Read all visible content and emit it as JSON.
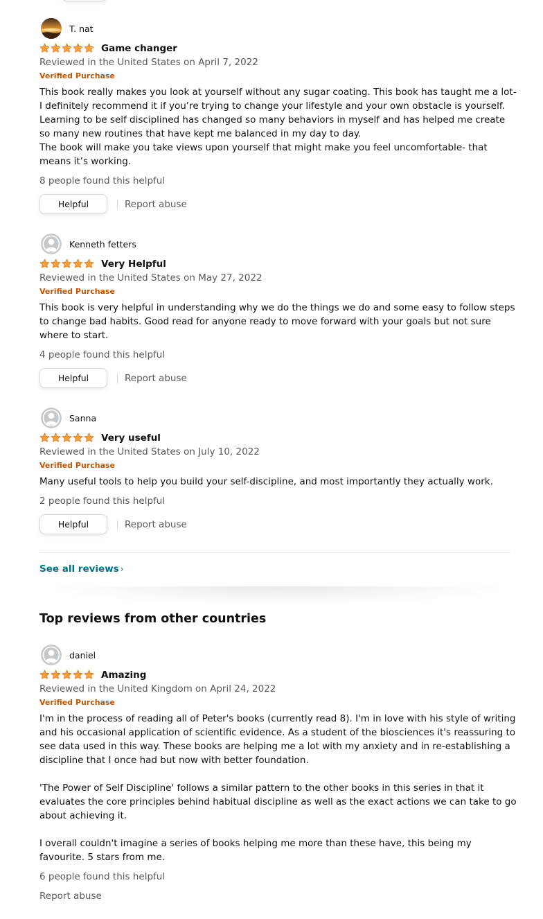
{
  "reviews": [
    {
      "name": "T. nat",
      "avatar": "photo",
      "rating": 5,
      "title": "Game changer",
      "date": "Reviewed in the United States on April 7, 2022",
      "verified": "Verified Purchase",
      "body": "This book really makes you look at yourself without any sugar coating. This book has taught me a lot- I definitely recommend it if you’re trying to change your lifestyle and your own obstacle is yourself.\nLearning to be self disciplined has changed so many behaviors in myself and has helped me create so many new routines that have kept me balanced in my day to day.\nThe book will make you take views upon yourself that might make you feel uncomfortable- that means it’s working.",
      "helpful_count": "8 people found this helpful",
      "helpful_label": "Helpful",
      "report_label": "Report abuse"
    },
    {
      "name": "Kenneth fetters",
      "avatar": "default",
      "rating": 5,
      "title": "Very Helpful",
      "date": "Reviewed in the United States on May 27, 2022",
      "verified": "Verified Purchase",
      "body": "This book is very helpful in understanding why we do the things we do and some easy to follow steps to change bad habits. Good read for anyone ready to move forward with your goals but not sure where to start.",
      "helpful_count": "4 people found this helpful",
      "helpful_label": "Helpful",
      "report_label": "Report abuse"
    },
    {
      "name": "Sanna",
      "avatar": "default",
      "rating": 5,
      "title": "Very useful",
      "date": "Reviewed in the United States on July 10, 2022",
      "verified": "Verified Purchase",
      "body": "Many useful tools to help you build your self-discipline, and most importantly they actually work.",
      "helpful_count": "2 people found this helpful",
      "helpful_label": "Helpful",
      "report_label": "Report abuse"
    }
  ],
  "see_all": {
    "label": "See all reviews",
    "chevron": "›"
  },
  "other_countries": {
    "heading": "Top reviews from other countries",
    "reviews": [
      {
        "name": "daniel",
        "avatar": "default",
        "rating": 5,
        "title": "Amazing",
        "date": "Reviewed in the United Kingdom on April 24, 2022",
        "verified": "Verified Purchase",
        "body": "I'm in the process of reading all of Peter's books (currently read 8). I'm in love with his style of writing and his occasional application of scientific evidence. As a student of the biosciences it's reassuring to see data used in this way. These books are helping me a lot with my anxiety and in re-establishing a discipline that I once had but now with better foundation.\n\n'The Power of Self Discipline' follows a similar pattern to the other books in this series in that it evaluates the core principles behind habitual discipline as well as the exact actions we can take to go about achieving it.\n\nI overall couldn't imagine a series of books helping me more than these have, this being my favourite. 5 stars from me.",
        "helpful_count": "6 people found this helpful",
        "report_label": "Report abuse"
      }
    ]
  },
  "colors": {
    "star": "#f7a33d",
    "star_stroke": "#de7921",
    "verified": "#c45500",
    "link": "#007185",
    "muted": "#565959"
  },
  "icons": {
    "star": "star-icon",
    "avatar": "user-avatar-icon",
    "chevron": "chevron-right-icon"
  }
}
